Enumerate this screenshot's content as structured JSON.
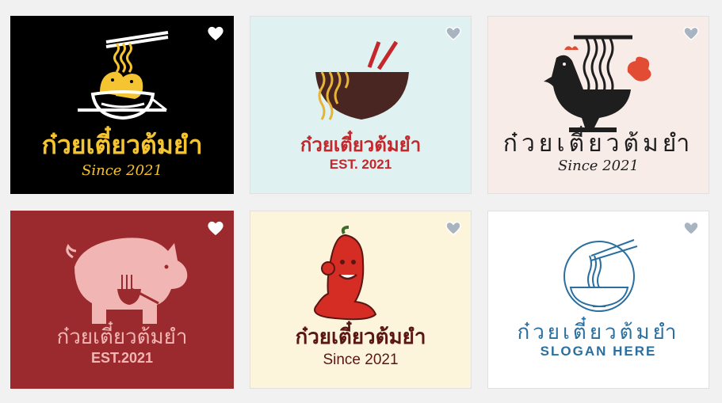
{
  "cards": [
    {
      "name": "ก๋วยเตี๋ยวต้มยำ",
      "tagline": "Since 2021",
      "bg": "#000000",
      "name_color": "#f5c431",
      "tag_color": "#f5c431"
    },
    {
      "name": "ก๋วยเตี๋ยวต้มยำ",
      "tagline": "EST. 2021",
      "bg": "#dff1f0",
      "name_color": "#c4272c",
      "tag_color": "#c4272c"
    },
    {
      "name": "ก๋วยเตี๋ยวต้มยำ",
      "tagline": "Since 2021",
      "bg": "#f8ece9",
      "name_color": "#1e1e1e",
      "tag_color": "#1e1e1e"
    },
    {
      "name": "ก๋วยเตี๋ยวต้มยำ",
      "tagline": "EST.2021",
      "bg": "#9b2a2e",
      "name_color": "#f1b6b4",
      "tag_color": "#f1b6b4"
    },
    {
      "name": "ก๋วยเตี๋ยวต้มยำ",
      "tagline": "Since 2021",
      "bg": "#fcf5dc",
      "name_color": "#5a1614",
      "tag_color": "#5a1614"
    },
    {
      "name": "ก๋วยเตี๋ยวต้มยำ",
      "tagline": "SLOGAN HERE",
      "bg": "#ffffff",
      "name_color": "#2a6f9f",
      "tag_color": "#2a6f9f"
    }
  ],
  "icons": {
    "favorite": "heart-icon"
  }
}
